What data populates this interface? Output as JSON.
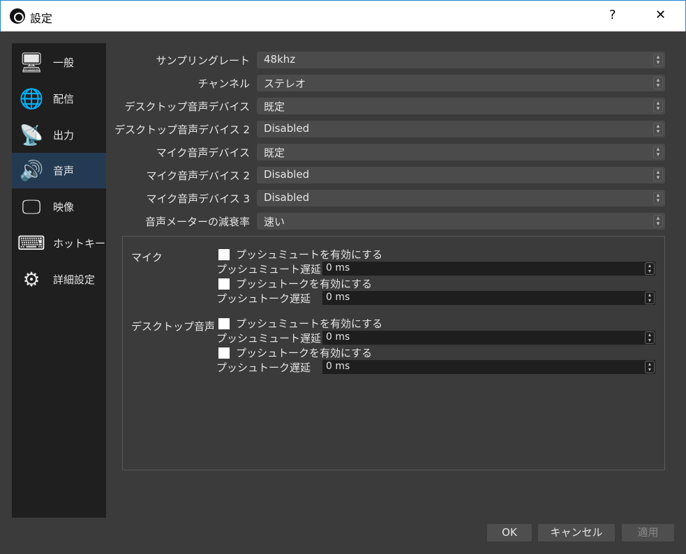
{
  "window": {
    "title": "設定",
    "help": "?",
    "close": "✕"
  },
  "sidebar": {
    "items": [
      {
        "label": "一般",
        "icon": "🖥"
      },
      {
        "label": "配信",
        "icon": "🌐"
      },
      {
        "label": "出力",
        "icon": "📡"
      },
      {
        "label": "音声",
        "icon": "🔊"
      },
      {
        "label": "映像",
        "icon": "🖵"
      },
      {
        "label": "ホットキー",
        "icon": "⌨"
      },
      {
        "label": "詳細設定",
        "icon": "⚙"
      }
    ],
    "selected": "音声"
  },
  "form": [
    {
      "label": "サンプリングレート",
      "value": "48khz"
    },
    {
      "label": "チャンネル",
      "value": "ステレオ"
    },
    {
      "label": "デスクトップ音声デバイス",
      "value": "既定"
    },
    {
      "label": "デスクトップ音声デバイス 2",
      "value": "Disabled"
    },
    {
      "label": "マイク音声デバイス",
      "value": "既定"
    },
    {
      "label": "マイク音声デバイス 2",
      "value": "Disabled"
    },
    {
      "label": "マイク音声デバイス 3",
      "value": "Disabled"
    },
    {
      "label": "音声メーターの減衰率",
      "value": "速い"
    }
  ],
  "hotkeys": [
    {
      "source": "マイク",
      "mute_enable": "プッシュミュートを有効にする",
      "mute_delay_label": "プッシュミュート遅延",
      "mute_delay": "0 ms",
      "talk_enable": "プッシュトークを有効にする",
      "talk_delay_label": "プッシュトーク遅延",
      "talk_delay": "0 ms"
    },
    {
      "source": "デスクトップ音声",
      "mute_enable": "プッシュミュートを有効にする",
      "mute_delay_label": "プッシュミュート遅延",
      "mute_delay": "0 ms",
      "talk_enable": "プッシュトークを有効にする",
      "talk_delay_label": "プッシュトーク遅延",
      "talk_delay": "0 ms"
    }
  ],
  "buttons": {
    "ok": "OK",
    "cancel": "キャンセル",
    "apply": "適用"
  }
}
